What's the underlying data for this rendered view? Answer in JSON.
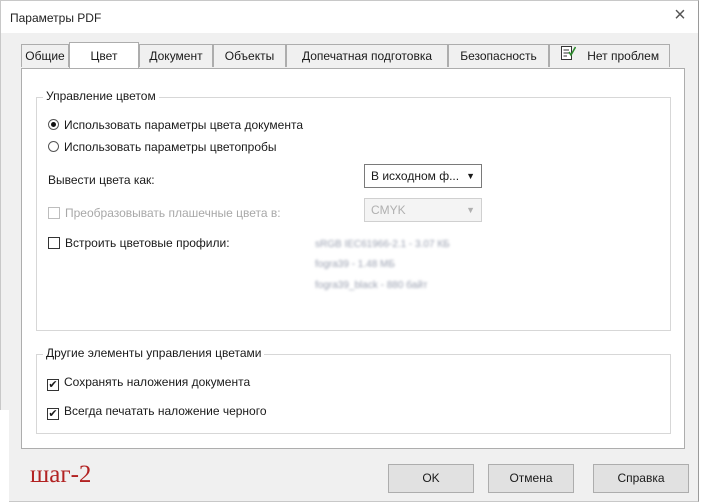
{
  "window": {
    "title": "Параметры PDF",
    "close_icon": "×"
  },
  "tabs": [
    {
      "label": "Общие"
    },
    {
      "label": "Цвет"
    },
    {
      "label": "Документ"
    },
    {
      "label": "Объекты"
    },
    {
      "label": "Допечатная подготовка"
    },
    {
      "label": "Безопасность"
    },
    {
      "label": "Нет проблем",
      "icon": "document-check-icon"
    }
  ],
  "active_tab": "Цвет",
  "color_management": {
    "title": "Управление цветом",
    "radio_document": "Использовать параметры цвета документа",
    "radio_proof": "Использовать параметры цветопробы",
    "selected_radio": "radio_document",
    "output_colors_label": "Вывести цвета как:",
    "output_colors_value": "В исходном ф...",
    "convert_spot_label": "Преобразовывать плашечные цвета в:",
    "convert_spot_checked": false,
    "convert_spot_value": "CMYK",
    "embed_profiles_label": "Встроить цветовые профили:",
    "embed_profiles_checked": false,
    "profiles": [
      "sRGB IEC61966-2.1 - 3.07 КБ",
      "fogra39 - 1.48 МБ",
      "fogra39_black - 880 байт"
    ]
  },
  "other_color": {
    "title": "Другие элементы управления цветами",
    "preserve_overprints_label": "Сохранять наложения документа",
    "preserve_overprints_checked": true,
    "always_overprint_black_label": "Всегда печатать наложение черного",
    "always_overprint_black_checked": true
  },
  "buttons": {
    "ok": "OK",
    "cancel": "Отмена",
    "help": "Справка"
  },
  "annotation": {
    "text": "шаг-2",
    "color": "#b22222"
  },
  "accent": {
    "check_icon_color": "#2e8b2e"
  }
}
